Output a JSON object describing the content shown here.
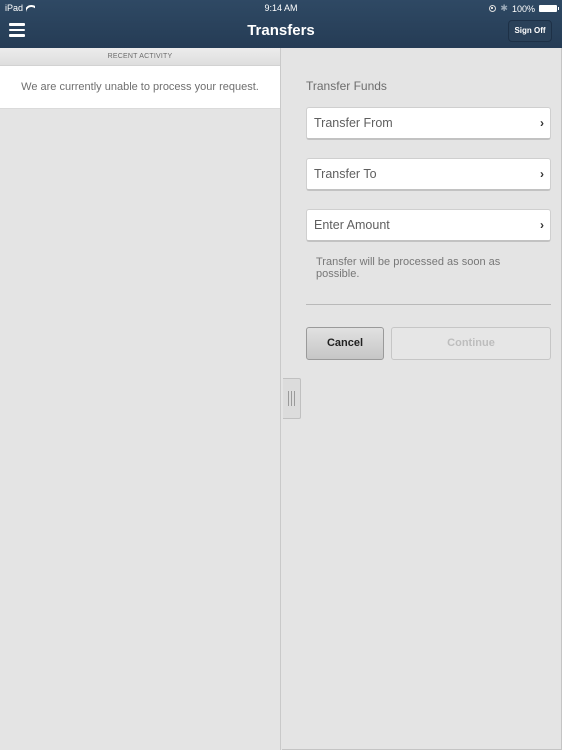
{
  "status_bar": {
    "carrier": "iPad",
    "time": "9:14 AM",
    "battery": "100%",
    "icons": [
      "wifi-icon",
      "orientation-lock-icon",
      "bluetooth-icon",
      "battery-icon"
    ]
  },
  "navbar": {
    "title": "Transfers",
    "menu_icon": "hamburger-menu-icon",
    "sign_off_label": "Sign Off"
  },
  "recent_activity": {
    "header": "RECENT ACTIVITY",
    "message": "We are currently unable to process your request."
  },
  "transfer": {
    "title": "Transfer Funds",
    "fields": [
      {
        "label": "Transfer From",
        "icon": "chevron-right-icon"
      },
      {
        "label": "Transfer To",
        "icon": "chevron-right-icon"
      },
      {
        "label": "Enter Amount",
        "icon": "chevron-right-icon"
      }
    ],
    "note": "Transfer will be processed as soon as possible.",
    "cancel_label": "Cancel",
    "continue_label": "Continue",
    "continue_enabled": false
  },
  "splitter": {
    "icon": "drag-handle-icon"
  }
}
